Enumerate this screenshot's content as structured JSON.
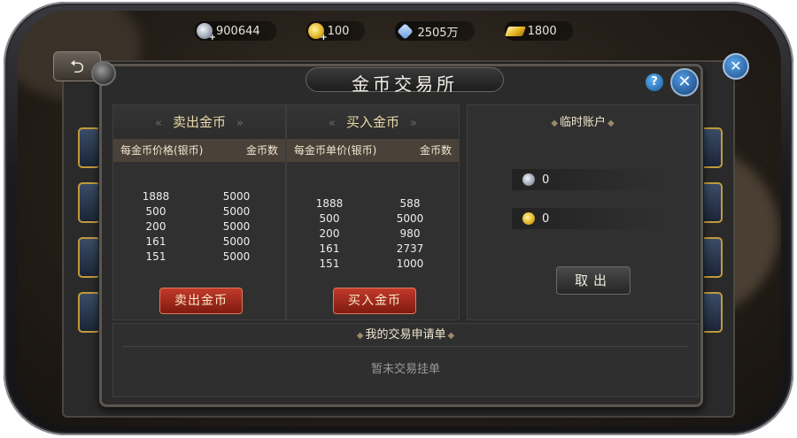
{
  "resources": [
    {
      "icon": "silver-coin-icon",
      "value": "900644"
    },
    {
      "icon": "gold-coin-icon",
      "value": "100"
    },
    {
      "icon": "diamond-icon",
      "value": "2505万"
    },
    {
      "icon": "gold-bar-icon",
      "value": "1800"
    }
  ],
  "dialog": {
    "title": "金币交易所"
  },
  "sell": {
    "header": "卖出金币",
    "col_price": "每金币价格(银币)",
    "col_amount": "金币数",
    "rows": [
      {
        "price": "1888",
        "amount": "5000"
      },
      {
        "price": "500",
        "amount": "5000"
      },
      {
        "price": "200",
        "amount": "5000"
      },
      {
        "price": "161",
        "amount": "5000"
      },
      {
        "price": "151",
        "amount": "5000"
      }
    ],
    "button": "卖出金币"
  },
  "buy": {
    "header": "买入金币",
    "col_price": "每金币单价(银币)",
    "col_amount": "金币数",
    "rows": [
      {
        "price": "1888",
        "amount": "588"
      },
      {
        "price": "500",
        "amount": "5000"
      },
      {
        "price": "200",
        "amount": "980"
      },
      {
        "price": "161",
        "amount": "2737"
      },
      {
        "price": "151",
        "amount": "1000"
      }
    ],
    "button": "买入金币"
  },
  "temp_account": {
    "title": "临时账户",
    "silver": "0",
    "gold": "0",
    "withdraw": "取出"
  },
  "orders": {
    "title": "我的交易申请单",
    "empty": "暂未交易挂单"
  },
  "colors": {
    "accent_gold": "#e9d9a9",
    "button_red": "#c23a2a",
    "panel": "#2b2b2b"
  }
}
